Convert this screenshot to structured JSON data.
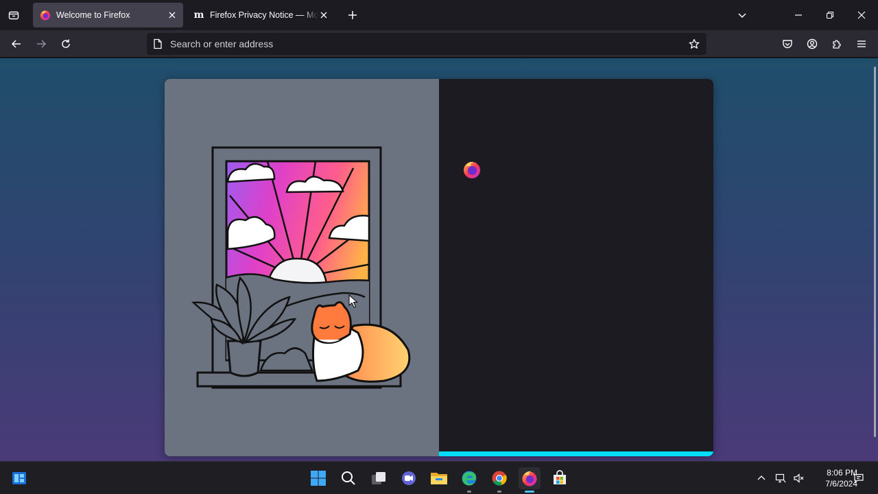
{
  "tabs": [
    {
      "title": "Welcome to Firefox",
      "active": true,
      "favicon": "firefox-icon"
    },
    {
      "title": "Firefox Privacy Notice — Mozilla",
      "active": false,
      "favicon": "mozilla-m-icon"
    }
  ],
  "favicon_letters": {
    "mozilla": "m"
  },
  "urlbar": {
    "placeholder": "Search or enter address",
    "value": ""
  },
  "onboarding": {
    "progress_percent": 100
  },
  "colors": {
    "accent": "#00ddff",
    "active_tab": "#42414d",
    "panel_dark": "#1c1b22",
    "illustration_bg": "#6b7280"
  },
  "taskbar": {
    "apps": [
      "start",
      "search",
      "task-view",
      "chat",
      "file-explorer",
      "edge",
      "chrome",
      "firefox",
      "store"
    ],
    "active_app": "firefox"
  },
  "clock": {
    "time": "8:06 PM",
    "date": "7/6/2024"
  }
}
